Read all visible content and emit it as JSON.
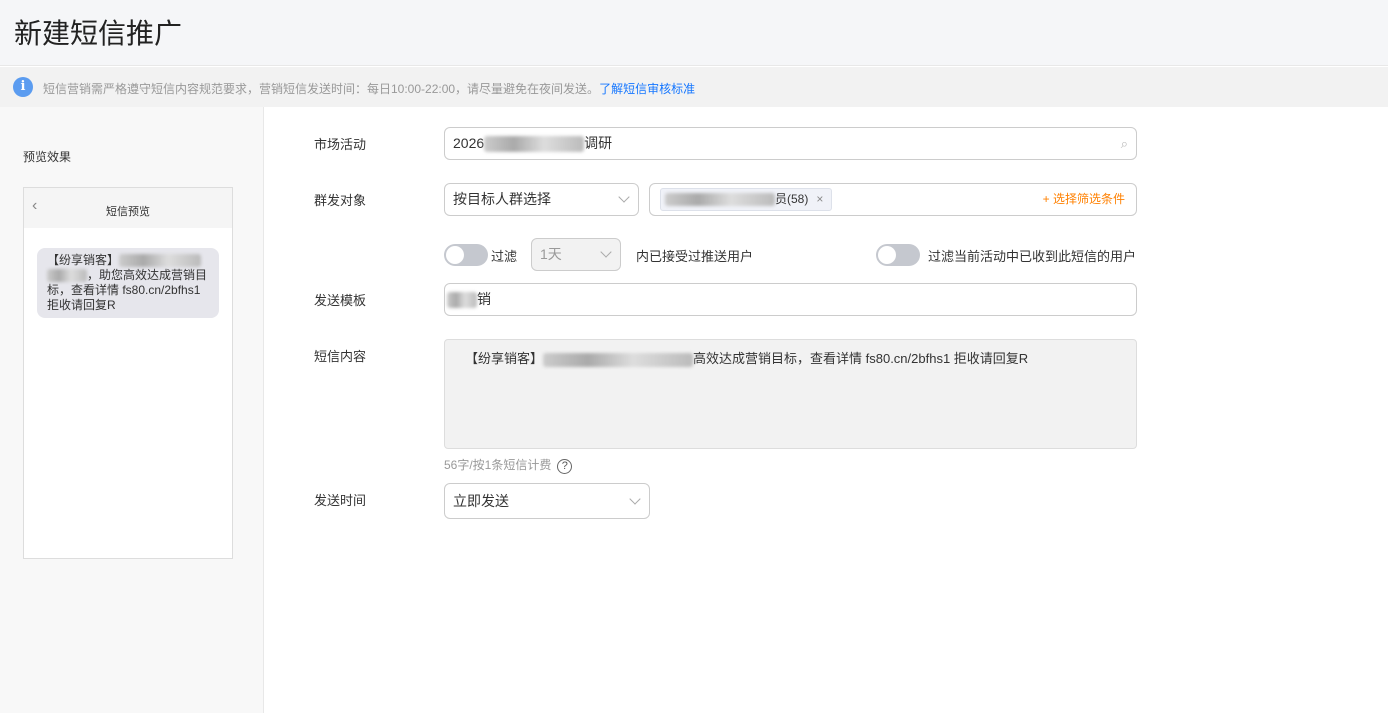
{
  "header": {
    "title": "新建短信推广"
  },
  "notice": {
    "text": "短信营销需严格遵守短信内容规范要求，营销短信发送时间：每日10:00-22:00，请尽量避免在夜间发送。",
    "link": "了解短信审核标准",
    "icon": "info-icon"
  },
  "preview": {
    "label": "预览效果",
    "phone_title": "短信预览",
    "bubble": {
      "line1": "【纷享销客】",
      "line2": "，助您高效达成营销目",
      "line3": "标，查看详情 fs80.cn/2bfhs1",
      "line4": "拒收请回复R"
    }
  },
  "form": {
    "market_activity": {
      "label": "市场活动",
      "value_prefix": "2026",
      "value_suffix": "调研"
    },
    "audience": {
      "label": "群发对象",
      "mode": "按目标人群选择",
      "tag_suffix": "员(58)",
      "add_condition": "+ 选择筛选条件"
    },
    "filter": {
      "label": "过滤",
      "days": "1天",
      "suffix": "内已接受过推送用户",
      "current_label": "过滤当前活动中已收到此短信的用户",
      "enabled": false,
      "current_enabled": false
    },
    "template": {
      "label": "发送模板",
      "value_suffix": "销"
    },
    "content": {
      "label": "短信内容",
      "prefix": "【纷享销客】",
      "suffix": "高效达成营销目标，查看详情  fs80.cn/2bfhs1 拒收请回复R",
      "hint": "56字/按1条短信计费"
    },
    "send_time": {
      "label": "发送时间",
      "value": "立即发送"
    }
  },
  "colors": {
    "accent": "#1677ff",
    "orange": "#ff8000",
    "info": "#5b9cf0"
  }
}
